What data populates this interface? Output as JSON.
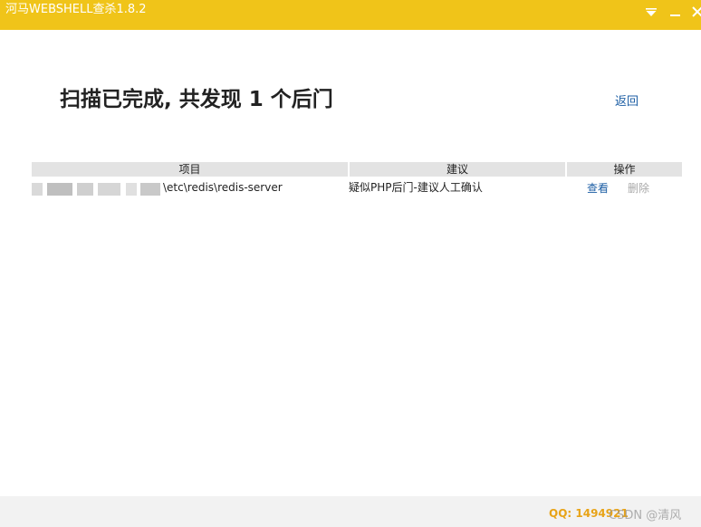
{
  "window": {
    "title": "河马WEBSHELL查杀1.8.2",
    "accent_color": "#f0c419",
    "controls": [
      "menu-triangle-icon",
      "minimize-icon",
      "close-icon"
    ]
  },
  "result": {
    "headline": "扫描已完成, 共发现 1 个后门",
    "back_label": "返回"
  },
  "table": {
    "columns": [
      "项目",
      "建议",
      "操作"
    ],
    "rows": [
      {
        "path": "\\etc\\redis\\redis-server",
        "advice": "疑似PHP后门-建议人工确认",
        "view_label": "查看",
        "delete_label": "删除"
      }
    ]
  },
  "footer": {
    "qq": "QQ: 1494921",
    "watermark": "CSDN @清风"
  }
}
